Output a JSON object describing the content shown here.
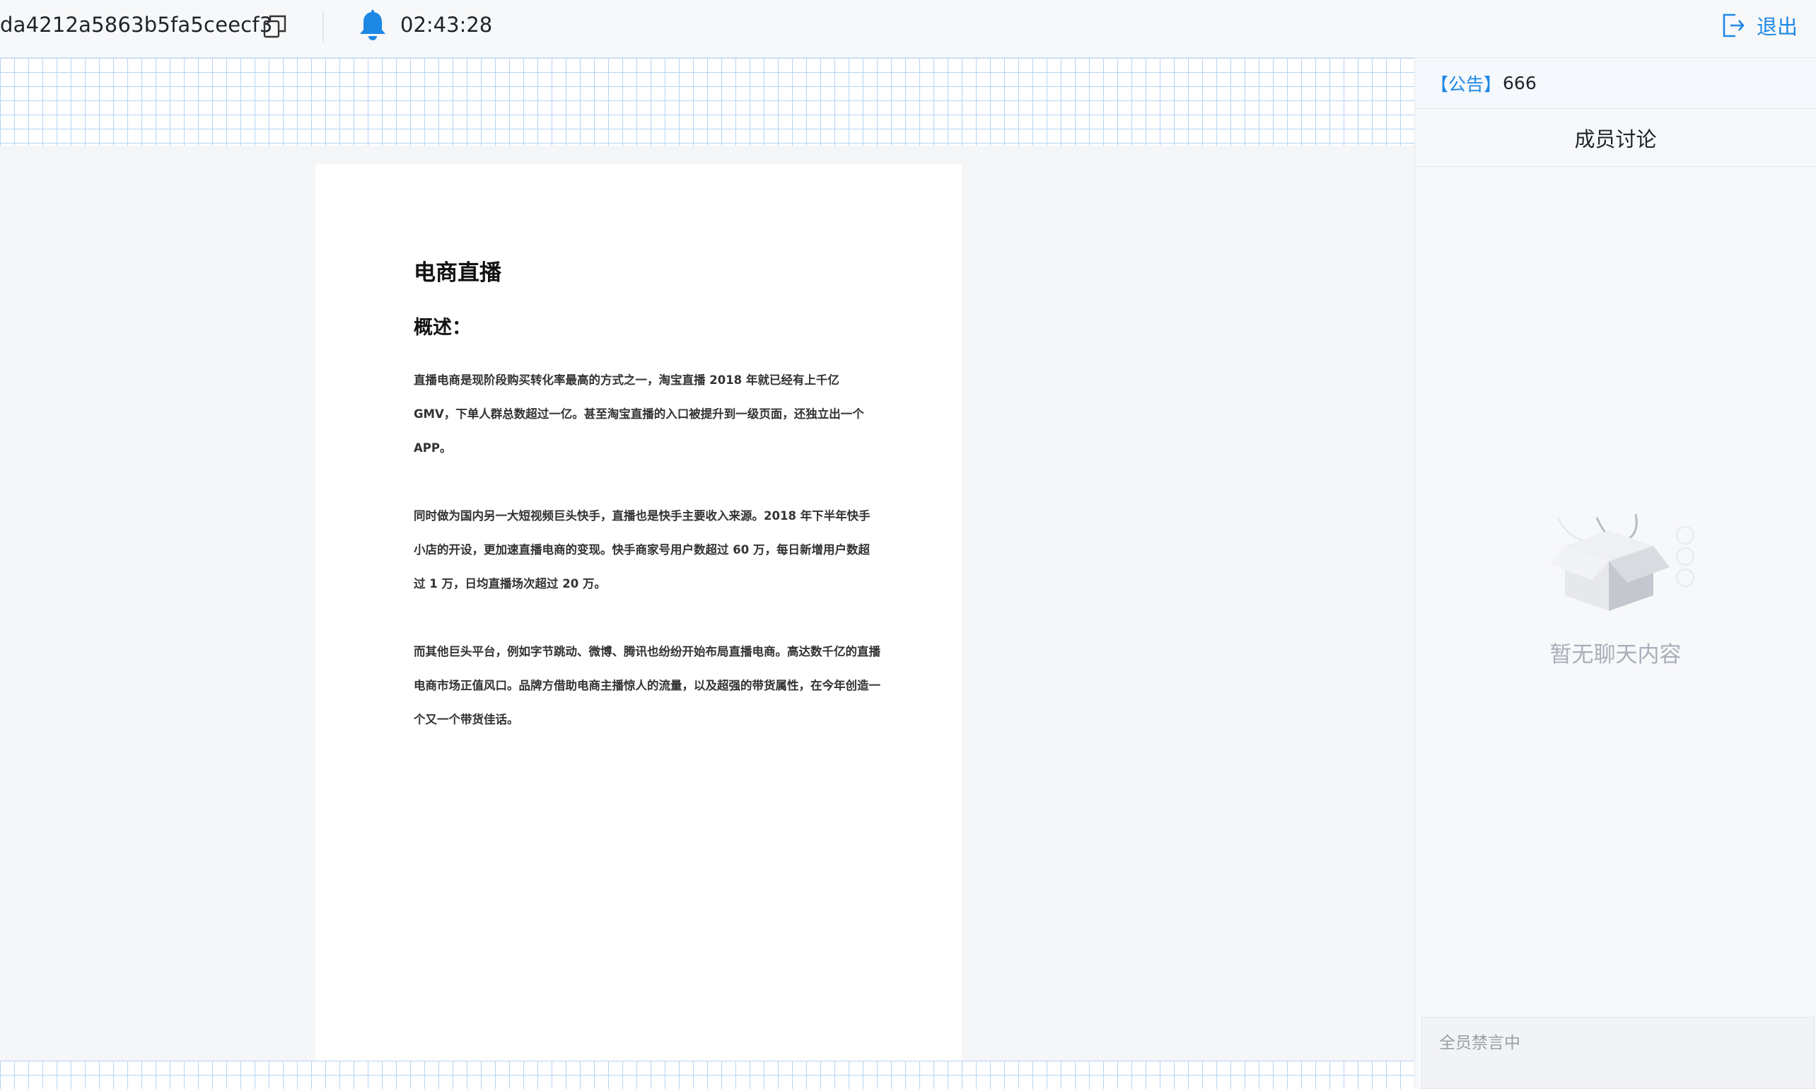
{
  "header": {
    "room_id": "da4212a5863b5fa5ceecf3",
    "timer": "02:43:28",
    "logout_label": "退出",
    "accent_color": "#1e88e5"
  },
  "document": {
    "title": "电商直播",
    "subtitle": "概述：",
    "paragraphs": [
      "直播电商是现阶段购买转化率最高的方式之一，淘宝直播 2018 年就已经有上千亿 GMV，下单人群总数超过一亿。甚至淘宝直播的入口被提升到一级页面，还独立出一个 APP。",
      "同时做为国内另一大短视频巨头快手，直播也是快手主要收入来源。2018 年下半年快手小店的开设，更加速直播电商的变现。快手商家号用户数超过 60 万，每日新增用户数超过 1 万，日均直播场次超过 20 万。",
      "而其他巨头平台，例如字节跳动、微博、腾讯也纷纷开始布局直播电商。高达数千亿的直播电商市场正值风口。品牌方借助电商主播惊人的流量，以及超强的带货属性，在今年创造一个又一个带货佳话。"
    ]
  },
  "panel": {
    "notice_tag": "【公告】",
    "notice_text": "666",
    "title": "成员讨论",
    "empty_text": "暂无聊天内容",
    "input_placeholder": "全员禁言中"
  }
}
